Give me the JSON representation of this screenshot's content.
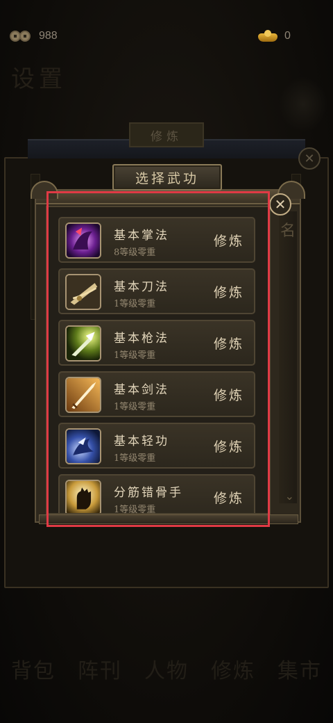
{
  "currency": {
    "coins": {
      "icon": "copper-coins-icon",
      "value": "988"
    },
    "ingots": {
      "icon": "gold-ingot-icon",
      "value": "0"
    }
  },
  "background": {
    "title": "设置",
    "back_tab": "修炼",
    "side_glyph": "名",
    "nav": [
      "背包",
      "阵刊",
      "人物",
      "修炼",
      "集市"
    ]
  },
  "modal": {
    "title": "选择武功",
    "close_icon": "close-icon",
    "skills": [
      {
        "name": "基本掌法",
        "level": "8等级零重",
        "action": "修炼",
        "icon": "palm-technique-icon"
      },
      {
        "name": "基本刀法",
        "level": "1等级零重",
        "action": "修炼",
        "icon": "blade-technique-icon"
      },
      {
        "name": "基本枪法",
        "level": "1等级零重",
        "action": "修炼",
        "icon": "spear-technique-icon"
      },
      {
        "name": "基本剑法",
        "level": "1等级零重",
        "action": "修炼",
        "icon": "sword-technique-icon"
      },
      {
        "name": "基本轻功",
        "level": "1等级零重",
        "action": "修炼",
        "icon": "lightness-skill-icon"
      },
      {
        "name": "分筋错骨手",
        "level": "1等级零重",
        "action": "修炼",
        "icon": "bone-breaking-hand-icon"
      }
    ]
  },
  "colors": {
    "highlight": "#e03a45",
    "text_primary": "#e3d6bb",
    "text_secondary": "#958871",
    "panel": "#2e281d"
  }
}
